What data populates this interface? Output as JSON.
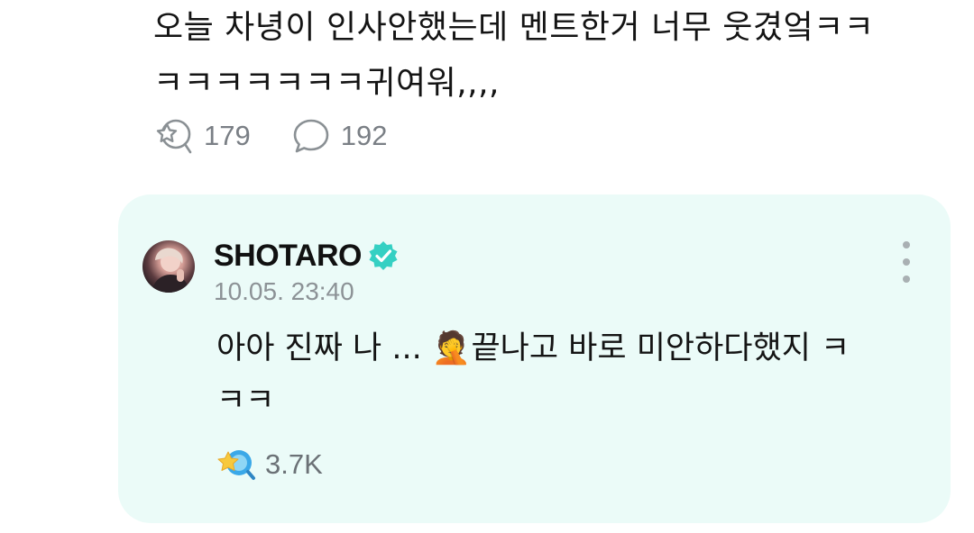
{
  "post": {
    "text": "오늘 차녕이 인사안했는데 멘트한거 너무 웃겼엌ㅋㅋ\nㅋㅋㅋㅋㅋㅋㅋ귀여워,,,,",
    "like_count": "179",
    "comment_count": "192"
  },
  "reply": {
    "author": "SHOTARO",
    "verified": true,
    "timestamp": "10.05. 23:40",
    "text": "아아 진짜 나 ... 🤦끝나고 바로 미안하다했지 ㅋ\nㅋㅋ",
    "reaction_count": "3.7K"
  },
  "icons": {
    "like": "star-bubble-outline-icon",
    "comment": "speech-bubble-outline-icon",
    "verified": "verified-badge-icon",
    "menu": "more-vertical-icon",
    "reaction": "star-bubble-filled-icon"
  },
  "colors": {
    "card_background": "#ebfbf8",
    "verified_badge": "#35d0c3",
    "icon_gray": "#8a9094",
    "reaction_blue": "#3aa8e8",
    "reaction_star": "#f7c93d"
  }
}
